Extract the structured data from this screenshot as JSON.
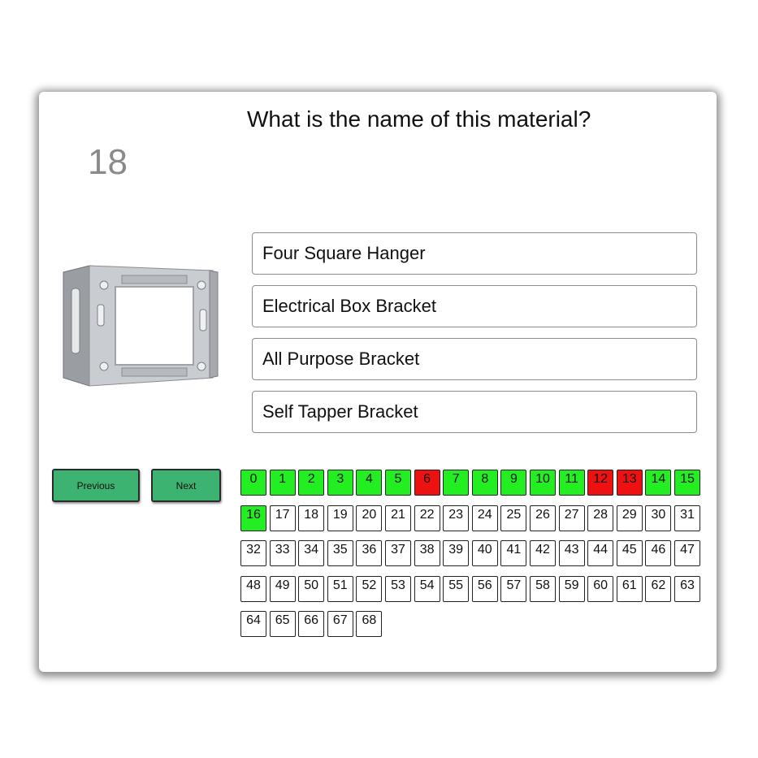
{
  "question": {
    "text": "What is the name of this material?",
    "number": "18"
  },
  "image": {
    "alt": "electrical box bracket"
  },
  "answers": [
    "Four Square Hanger",
    "Electrical Box Bracket",
    "All Purpose Bracket",
    "Self Tapper Bracket"
  ],
  "navigation": {
    "previous_label": "Previous",
    "next_label": "Next"
  },
  "question_grid": {
    "labels": [
      "0",
      "1",
      "2",
      "3",
      "4",
      "5",
      "6",
      "7",
      "8",
      "9",
      "10",
      "11",
      "12",
      "13",
      "14",
      "15",
      "16",
      "17",
      "18",
      "19",
      "20",
      "21",
      "22",
      "23",
      "24",
      "25",
      "26",
      "27",
      "28",
      "29",
      "30",
      "31",
      "32",
      "33",
      "34",
      "35",
      "36",
      "37",
      "38",
      "39",
      "40",
      "41",
      "42",
      "43",
      "44",
      "45",
      "46",
      "47",
      "48",
      "49",
      "50",
      "51",
      "52",
      "53",
      "54",
      "55",
      "56",
      "57",
      "58",
      "59",
      "60",
      "61",
      "62",
      "63",
      "64",
      "65",
      "66",
      "67",
      "68"
    ],
    "statuses": [
      "correct",
      "correct",
      "correct",
      "correct",
      "correct",
      "correct",
      "wrong",
      "correct",
      "correct",
      "correct",
      "correct",
      "correct",
      "wrong",
      "wrong",
      "correct",
      "correct",
      "correct",
      "unanswered",
      "unanswered",
      "unanswered",
      "unanswered",
      "unanswered",
      "unanswered",
      "unanswered",
      "unanswered",
      "unanswered",
      "unanswered",
      "unanswered",
      "unanswered",
      "unanswered",
      "unanswered",
      "unanswered",
      "unanswered",
      "unanswered",
      "unanswered",
      "unanswered",
      "unanswered",
      "unanswered",
      "unanswered",
      "unanswered",
      "unanswered",
      "unanswered",
      "unanswered",
      "unanswered",
      "unanswered",
      "unanswered",
      "unanswered",
      "unanswered",
      "unanswered",
      "unanswered",
      "unanswered",
      "unanswered",
      "unanswered",
      "unanswered",
      "unanswered",
      "unanswered",
      "unanswered",
      "unanswered",
      "unanswered",
      "unanswered",
      "unanswered",
      "unanswered",
      "unanswered",
      "unanswered",
      "unanswered",
      "unanswered",
      "unanswered",
      "unanswered",
      "unanswered"
    ],
    "colors": {
      "correct": "#22ee22",
      "wrong": "#ee1111",
      "unanswered": "#ffffff"
    }
  },
  "colors": {
    "nav_button": "#3cb371",
    "question_number": "#8a8a8a"
  }
}
